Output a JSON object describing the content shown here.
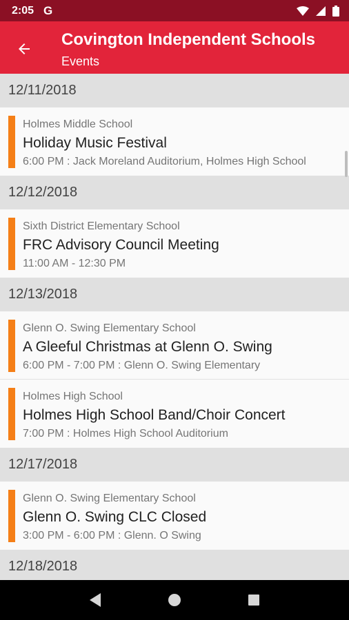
{
  "status_bar": {
    "time": "2:05",
    "g_label": "G"
  },
  "app_bar": {
    "title": "Covington Independent Schools",
    "subtitle": "Events"
  },
  "groups": [
    {
      "date": "12/11/2018",
      "events": [
        {
          "school": "Holmes Middle School",
          "title": "Holiday Music Festival",
          "detail": "6:00 PM : Jack Moreland Auditorium, Holmes High School"
        }
      ]
    },
    {
      "date": "12/12/2018",
      "events": [
        {
          "school": "Sixth District Elementary School",
          "title": "FRC Advisory Council Meeting",
          "detail": "11:00 AM - 12:30 PM"
        }
      ]
    },
    {
      "date": "12/13/2018",
      "events": [
        {
          "school": "Glenn O. Swing Elementary School",
          "title": "A Gleeful Christmas at Glenn O. Swing",
          "detail": "6:00 PM - 7:00 PM : Glenn O. Swing Elementary"
        },
        {
          "school": "Holmes High School",
          "title": "Holmes High School Band/Choir Concert",
          "detail": "7:00 PM : Holmes High School Auditorium"
        }
      ]
    },
    {
      "date": "12/17/2018",
      "events": [
        {
          "school": "Glenn O. Swing Elementary School",
          "title": "Glenn O. Swing CLC Closed",
          "detail": "3:00 PM - 6:00 PM : Glenn. O Swing"
        }
      ]
    },
    {
      "date": "12/18/2018",
      "events": []
    }
  ],
  "colors": {
    "status_bar": "#8b1024",
    "app_bar": "#e2243a",
    "event_accent": "#f57f17",
    "date_header_bg": "#e0e0e0"
  },
  "icons": {
    "back": "arrow-left-icon",
    "wifi": "wifi-icon",
    "signal": "signal-icon",
    "battery": "battery-icon",
    "nav_back": "triangle-back-icon",
    "nav_home": "circle-home-icon",
    "nav_recents": "square-recents-icon"
  }
}
